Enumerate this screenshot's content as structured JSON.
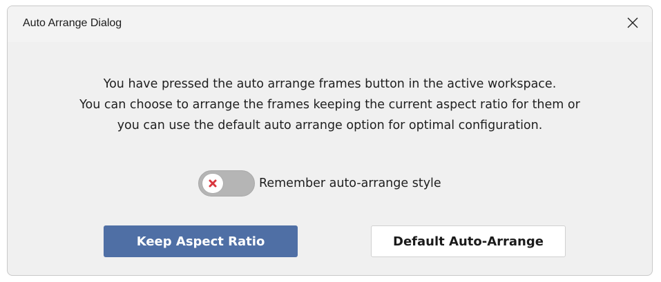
{
  "dialog": {
    "title": "Auto Arrange Dialog",
    "close_icon": "close-icon",
    "message_lines": [
      "You have pressed the auto arrange frames button in the active workspace.",
      "You can choose to arrange the frames keeping the current aspect ratio for them or",
      "you can use the default auto arrange option for optimal configuration."
    ],
    "remember": {
      "label": "Remember auto-arrange style",
      "checked": false,
      "icon": "x-mark-icon"
    },
    "buttons": {
      "keep_aspect_label": "Keep Aspect Ratio",
      "default_label": "Default Auto-Arrange"
    },
    "colors": {
      "primary_button": "#4f6fa5",
      "toggle_off_mark": "#d9363e"
    }
  }
}
